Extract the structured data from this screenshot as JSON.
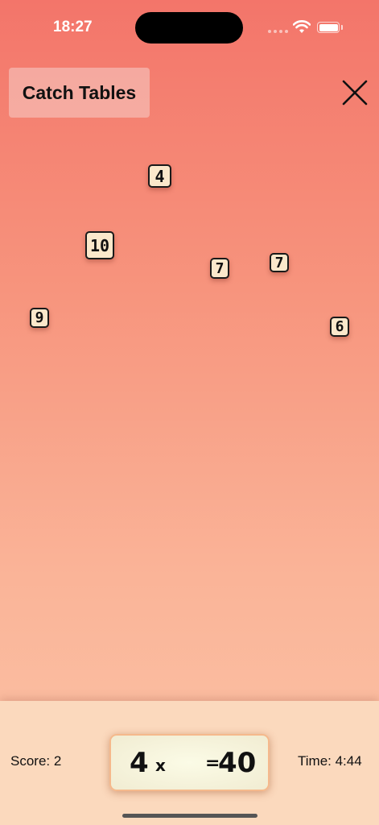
{
  "status_bar": {
    "time": "18:27",
    "icons": [
      "cellular-signal-icon",
      "wifi-icon",
      "battery-icon"
    ]
  },
  "header": {
    "title": "Catch Tables",
    "close_icon": "close-icon"
  },
  "falling_numbers": [
    "4",
    "10",
    "7",
    "7",
    "9",
    "6"
  ],
  "bottom_bar": {
    "score": "Score: 2",
    "time_remaining": "Time: 4:44",
    "equation": {
      "multiplicand": "4",
      "operator": "x",
      "equals": "=",
      "result": "40"
    }
  },
  "colors": {
    "background_top": "#f3756a",
    "background_bottom": "#fcc4a7",
    "tile_fill": "#fbe8cb",
    "bottom_bar": "#fbd9bd"
  }
}
